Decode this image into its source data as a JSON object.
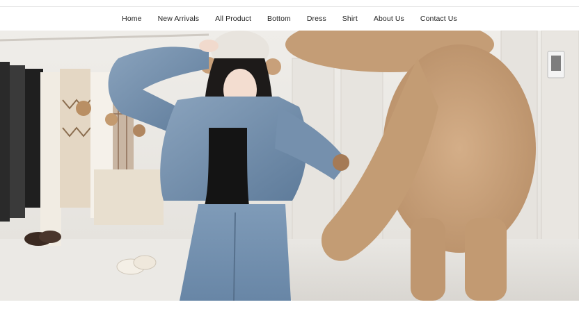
{
  "nav": {
    "items": [
      {
        "label": "Home"
      },
      {
        "label": "New Arrivals"
      },
      {
        "label": "All Product"
      },
      {
        "label": "Bottom"
      },
      {
        "label": "Dress"
      },
      {
        "label": "Shirt"
      },
      {
        "label": "About Us"
      },
      {
        "label": "Contact Us"
      }
    ]
  },
  "colors": {
    "nav_text": "#222222",
    "wall": "#eceae6",
    "bear_fur": "#c9a27c",
    "denim": "#6d8aa8"
  }
}
